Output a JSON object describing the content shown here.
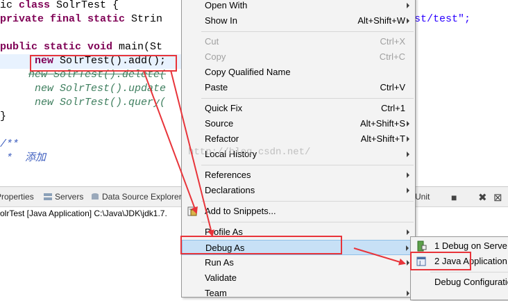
{
  "editor": {
    "lines": {
      "l1a": "ic ",
      "l1b": "class",
      "l1c": " SolrTest {",
      "l2a": "private ",
      "l2b": "final ",
      "l2c": "static ",
      "l2d": "Strin",
      "l2e": "st/test",
      "l2f": "\";",
      "l3a": "public ",
      "l3b": "static ",
      "l3c": "void ",
      "l3d": "main(St",
      "l4a": "new ",
      "l4b": "SolrTest().add();",
      "l5": "new SolrTest().delete(",
      "l6a": "new ",
      "l6b": "SolrTest().update",
      "l7a": "new ",
      "l7b": "SolrTest().query(",
      "l8": "}",
      "l9": "/**",
      "l10": " *  添加"
    }
  },
  "panel": {
    "tabs": [
      "Properties",
      "Servers",
      "Data Source Explorer",
      "Unit"
    ],
    "console_text": "olrTest [Java Application] C:\\Java\\JDK\\jdk1.7."
  },
  "context_menu": {
    "items": [
      {
        "label": "Open With",
        "accel": ""
      },
      {
        "label": "Show In",
        "accel": "Alt+Shift+W"
      },
      {
        "label": "Cut",
        "accel": "Ctrl+X"
      },
      {
        "label": "Copy",
        "accel": "Ctrl+C"
      },
      {
        "label": "Copy Qualified Name",
        "accel": ""
      },
      {
        "label": "Paste",
        "accel": "Ctrl+V"
      },
      {
        "label": "Quick Fix",
        "accel": "Ctrl+1"
      },
      {
        "label": "Source",
        "accel": "Alt+Shift+S"
      },
      {
        "label": "Refactor",
        "accel": "Alt+Shift+T"
      },
      {
        "label": "Local History",
        "accel": ""
      },
      {
        "label": "References",
        "accel": ""
      },
      {
        "label": "Declarations",
        "accel": ""
      },
      {
        "label": "Add to Snippets...",
        "accel": ""
      },
      {
        "label": "Profile As",
        "accel": ""
      },
      {
        "label": "Debug As",
        "accel": ""
      },
      {
        "label": "Run As",
        "accel": ""
      },
      {
        "label": "Validate",
        "accel": ""
      },
      {
        "label": "Team",
        "accel": ""
      }
    ]
  },
  "submenu": {
    "items": [
      {
        "label": "1 Debug on Serve"
      },
      {
        "label": "2 Java Application"
      },
      {
        "label": "Debug Configuratio"
      }
    ]
  },
  "watermark": "http://blog.csdn.net/",
  "colors": {
    "annotation_red": "#e8343a",
    "highlight": "#c7e0f6",
    "keyword": "#7f0055",
    "string": "#2a00ff"
  }
}
